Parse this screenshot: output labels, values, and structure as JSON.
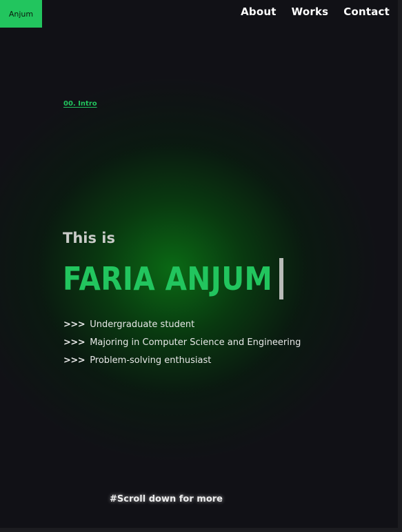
{
  "colors": {
    "accent": "#22c55e",
    "background": "#111116",
    "glow": "#0a6e14",
    "text": "#ffffff"
  },
  "header": {
    "logo_label": "Anjum",
    "nav": [
      {
        "label": "About"
      },
      {
        "label": "Works"
      },
      {
        "label": "Contact"
      }
    ]
  },
  "hero": {
    "section_label": "00. Intro",
    "intro": "This is",
    "name": "FARIA ANJUM",
    "bullet_marker": ">>>",
    "bullets": [
      "Undergraduate student",
      "Majoring in Computer Science and Engineering",
      "Problem-solving enthusiast"
    ],
    "scroll_hint": "#Scroll down for more"
  }
}
